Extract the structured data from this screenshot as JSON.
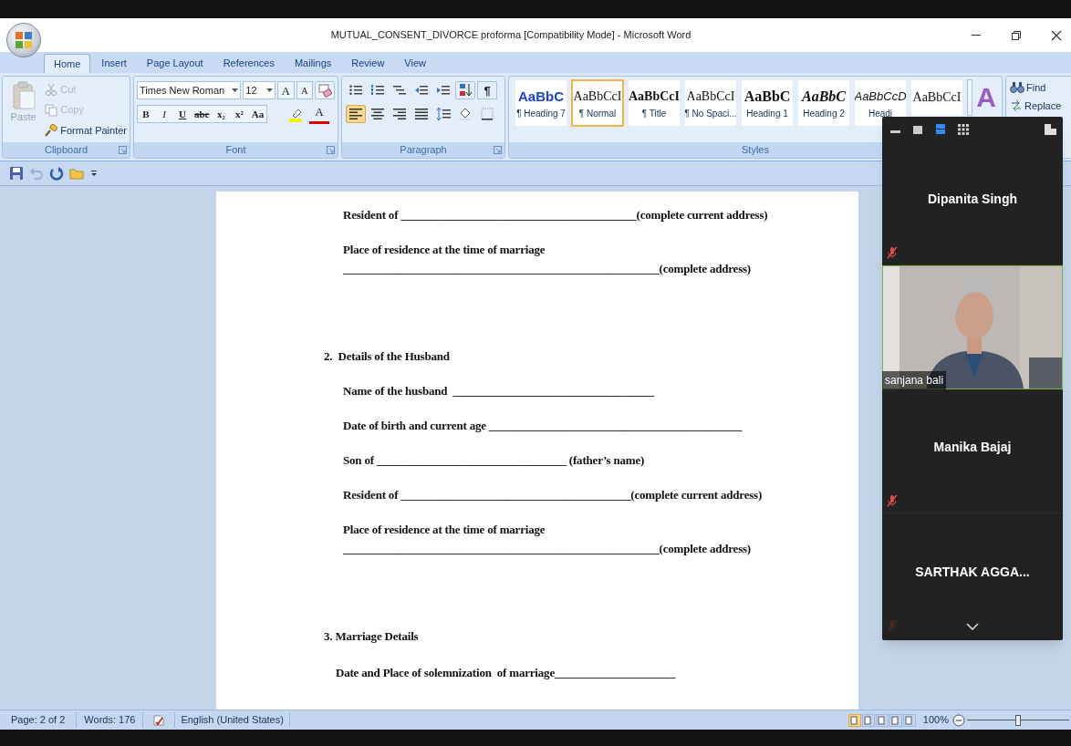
{
  "window": {
    "title": "MUTUAL_CONSENT_DIVORCE proforma [Compatibility Mode] - Microsoft Word"
  },
  "tabs": [
    {
      "label": "Home",
      "selected": true
    },
    {
      "label": "Insert",
      "selected": false
    },
    {
      "label": "Page Layout",
      "selected": false
    },
    {
      "label": "References",
      "selected": false
    },
    {
      "label": "Mailings",
      "selected": false
    },
    {
      "label": "Review",
      "selected": false
    },
    {
      "label": "View",
      "selected": false
    }
  ],
  "clipboard": {
    "label": "Clipboard",
    "paste": {
      "label": "Paste",
      "disabled": true
    },
    "cut": {
      "label": "Cut",
      "disabled": true
    },
    "copy": {
      "label": "Copy",
      "disabled": true
    },
    "format_painter": {
      "label": "Format Painter",
      "disabled": false
    }
  },
  "font": {
    "label": "Font",
    "family": "Times New Roman",
    "size": "12",
    "grow": "A",
    "shrink": "A",
    "format_buttons": [
      {
        "label": "B",
        "kind": "bold"
      },
      {
        "label": "I",
        "kind": "italic"
      },
      {
        "label": "U",
        "kind": "underline"
      },
      {
        "label": "abc",
        "kind": "strike"
      },
      {
        "label": "x₂",
        "kind": "plain"
      },
      {
        "label": "x²",
        "kind": "plain"
      },
      {
        "label": "Aa",
        "kind": "plain"
      }
    ],
    "font_color": "A"
  },
  "paragraph": {
    "label": "Paragraph",
    "show_marks": "¶",
    "align_buttons": [
      {
        "kind": "left",
        "selected": true
      },
      {
        "kind": "center",
        "selected": false
      },
      {
        "kind": "right",
        "selected": false
      },
      {
        "kind": "justify",
        "selected": false
      }
    ]
  },
  "styles": {
    "label": "Styles",
    "items": [
      {
        "preview": "AaBbC",
        "name": "¶ Heading 7",
        "kind": "blue",
        "selected": false
      },
      {
        "preview": "AaBbCcI",
        "name": "¶ Normal",
        "kind": "serif",
        "selected": true
      },
      {
        "preview": "AaBbCcI",
        "name": "¶ Title",
        "kind": "serif_bold",
        "selected": false
      },
      {
        "preview": "AaBbCcI",
        "name": "¶ No Spaci...",
        "kind": "serif",
        "selected": false
      },
      {
        "preview": "AaBbC",
        "name": "Heading 1",
        "kind": "large",
        "selected": false
      },
      {
        "preview": "AaBbC",
        "name": "Heading 2",
        "kind": "bold_italic",
        "selected": false
      },
      {
        "preview": "AaBbCcD",
        "name": "Headi",
        "kind": "italic",
        "selected": false
      },
      {
        "preview": "AaBbCcI",
        "kind": "serif",
        "selected": false
      }
    ],
    "change_styles": "A"
  },
  "editing": {
    "find": "Find",
    "replace": "Replace"
  },
  "quick_access": {
    "undo_disabled": true
  },
  "document": {
    "lines": [
      {
        "kind": "field",
        "text": "Resident of _________________________________________(complete current address)"
      },
      {
        "kind": "field",
        "text": "Place of residence at the time of marriage"
      },
      {
        "kind": "continuation",
        "text": "_______________________________________________________(complete address)"
      },
      {
        "kind": "heading",
        "text": "2.  Details of the Husband"
      },
      {
        "kind": "field",
        "text": "Name of the husband  ___________________________________"
      },
      {
        "kind": "field",
        "text": "Date of birth and current age ____________________________________________"
      },
      {
        "kind": "field",
        "text": "Son of _________________________________ (father’s name)"
      },
      {
        "kind": "field",
        "text": "Resident of ________________________________________(complete current address)"
      },
      {
        "kind": "field",
        "text": "Place of residence at the time of marriage"
      },
      {
        "kind": "continuation",
        "text": "_______________________________________________________(complete address)"
      },
      {
        "kind": "heading",
        "text": "3. Marriage Details"
      },
      {
        "kind": "subfield",
        "text": "Date and Place of solemnization  of marriage_____________________"
      }
    ]
  },
  "meeting": {
    "participants": [
      {
        "name": "Dipanita Singh",
        "kind": "name",
        "muted": true
      },
      {
        "name": "sanjana bali",
        "kind": "video",
        "muted": false
      },
      {
        "name": "Manika Bajaj",
        "kind": "name",
        "muted": true
      },
      {
        "name": "SARTHAK AGGA...",
        "kind": "name",
        "muted": true
      }
    ]
  },
  "status_bar": {
    "page": "Page: 2 of 2",
    "words": "Words: 176",
    "language": "English (United States)",
    "zoom": "100%",
    "zoom_level": {
      "level": 0.5
    }
  }
}
